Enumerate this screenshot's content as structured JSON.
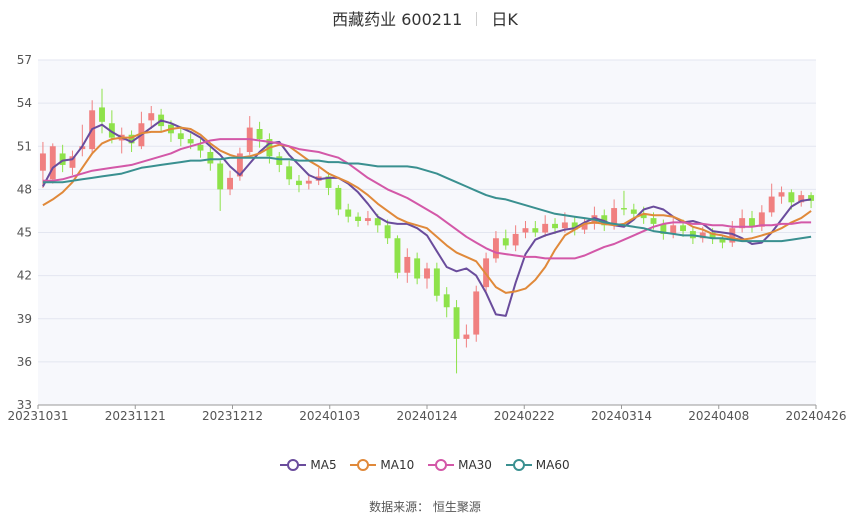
{
  "title": {
    "name": "西藏药业 600211",
    "period": "日K"
  },
  "source": "数据来源： 恒生聚源",
  "chart_data": {
    "type": "candlestick",
    "x_ticks": [
      "20231031",
      "20231121",
      "20231212",
      "20240103",
      "20240124",
      "20240222",
      "20240314",
      "20240408",
      "20240426"
    ],
    "y_ticks": [
      33,
      36,
      39,
      42,
      45,
      48,
      51,
      54,
      57
    ],
    "ylim": [
      33,
      57
    ],
    "grid": true,
    "legend_position": "bottom",
    "candle_colors": {
      "up": "#f08080",
      "down": "#8ee24a"
    },
    "series": [
      {
        "name": "MA5",
        "color": "#6a4c9c",
        "values": [
          48.2,
          49.5,
          50.0,
          50.1,
          51.0,
          52.2,
          52.5,
          52.0,
          51.6,
          51.3,
          51.8,
          52.3,
          52.8,
          52.6,
          52.3,
          52.0,
          51.6,
          51.0,
          50.4,
          49.6,
          49.0,
          49.8,
          50.6,
          51.2,
          51.3,
          50.4,
          49.7,
          49.0,
          48.7,
          48.8,
          48.8,
          48.4,
          47.8,
          47.0,
          46.1,
          45.7,
          45.6,
          45.6,
          45.3,
          44.8,
          43.7,
          42.6,
          42.3,
          42.5,
          42.0,
          40.8,
          39.3,
          39.2,
          41.5,
          43.5,
          44.5,
          44.8,
          45.0,
          45.2,
          45.3,
          45.7,
          46.0,
          45.8,
          45.5,
          45.4,
          45.9,
          46.6,
          46.8,
          46.6,
          46.1,
          45.7,
          45.8,
          45.6,
          45.1,
          45.0,
          44.9,
          44.6,
          44.2,
          44.3,
          45.0,
          45.9,
          46.8,
          47.2,
          47.3
        ]
      },
      {
        "name": "MA10",
        "color": "#e0893a",
        "values": [
          46.9,
          47.3,
          47.8,
          48.5,
          49.5,
          50.5,
          51.2,
          51.5,
          51.6,
          51.6,
          51.9,
          52.0,
          52.0,
          52.2,
          52.3,
          52.2,
          51.8,
          51.2,
          50.7,
          50.4,
          50.2,
          50.3,
          50.5,
          50.9,
          51.1,
          51.0,
          50.5,
          50.0,
          49.6,
          49.1,
          48.8,
          48.5,
          48.1,
          47.6,
          47.0,
          46.5,
          46.0,
          45.7,
          45.5,
          45.3,
          44.7,
          44.1,
          43.6,
          43.3,
          43.0,
          42.1,
          41.2,
          40.8,
          40.9,
          41.1,
          41.7,
          42.6,
          43.8,
          44.8,
          45.2,
          45.6,
          45.7,
          45.6,
          45.5,
          45.6,
          46.0,
          46.3,
          46.2,
          46.2,
          46.1,
          45.8,
          45.4,
          45.2,
          44.9,
          44.8,
          44.6,
          44.5,
          44.6,
          44.8,
          45.0,
          45.3,
          45.7,
          46.0,
          46.5
        ]
      },
      {
        "name": "MA30",
        "color": "#d358a8",
        "values": [
          48.6,
          48.6,
          48.7,
          48.9,
          49.1,
          49.3,
          49.4,
          49.5,
          49.6,
          49.7,
          49.9,
          50.1,
          50.3,
          50.5,
          50.8,
          51.0,
          51.2,
          51.4,
          51.5,
          51.5,
          51.5,
          51.5,
          51.4,
          51.3,
          51.2,
          51.0,
          50.8,
          50.7,
          50.6,
          50.4,
          50.2,
          49.8,
          49.3,
          48.8,
          48.4,
          48.0,
          47.7,
          47.4,
          47.0,
          46.6,
          46.2,
          45.7,
          45.2,
          44.7,
          44.3,
          43.9,
          43.6,
          43.5,
          43.4,
          43.3,
          43.3,
          43.2,
          43.2,
          43.2,
          43.2,
          43.4,
          43.7,
          44.0,
          44.2,
          44.5,
          44.8,
          45.1,
          45.4,
          45.6,
          45.7,
          45.7,
          45.6,
          45.6,
          45.5,
          45.5,
          45.4,
          45.4,
          45.4,
          45.5,
          45.5,
          45.6,
          45.6,
          45.7,
          45.7
        ]
      },
      {
        "name": "MA60",
        "color": "#3a9090",
        "values": [
          48.5,
          48.5,
          48.5,
          48.6,
          48.7,
          48.8,
          48.9,
          49.0,
          49.1,
          49.3,
          49.5,
          49.6,
          49.7,
          49.8,
          49.9,
          50.0,
          50.0,
          50.1,
          50.1,
          50.2,
          50.2,
          50.2,
          50.2,
          50.2,
          50.1,
          50.1,
          50.0,
          50.0,
          50.0,
          49.9,
          49.9,
          49.8,
          49.8,
          49.7,
          49.6,
          49.6,
          49.6,
          49.6,
          49.5,
          49.3,
          49.1,
          48.8,
          48.5,
          48.2,
          47.9,
          47.6,
          47.4,
          47.3,
          47.1,
          46.9,
          46.7,
          46.5,
          46.3,
          46.2,
          46.1,
          46.0,
          45.9,
          45.7,
          45.6,
          45.5,
          45.4,
          45.3,
          45.1,
          45.0,
          44.9,
          44.8,
          44.8,
          44.7,
          44.6,
          44.6,
          44.5,
          44.4,
          44.4,
          44.4,
          44.4,
          44.4,
          44.5,
          44.6,
          44.7
        ]
      }
    ],
    "candles": [
      [
        49.3,
        50.5,
        51.3,
        48.1
      ],
      [
        48.7,
        51.0,
        51.2,
        48.4
      ],
      [
        50.5,
        49.7,
        51.1,
        49.2
      ],
      [
        49.5,
        50.3,
        50.7,
        49.0
      ],
      [
        50.8,
        51.0,
        52.5,
        50.3
      ],
      [
        50.8,
        53.5,
        54.2,
        50.5
      ],
      [
        53.7,
        52.7,
        55.0,
        51.9
      ],
      [
        52.6,
        51.6,
        53.5,
        51.2
      ],
      [
        51.4,
        51.8,
        52.3,
        50.5
      ],
      [
        51.8,
        51.2,
        52.1,
        50.6
      ],
      [
        51.0,
        52.6,
        53.4,
        50.8
      ],
      [
        52.8,
        53.3,
        53.8,
        52.2
      ],
      [
        53.2,
        52.4,
        53.6,
        52.0
      ],
      [
        52.5,
        51.9,
        52.8,
        51.3
      ],
      [
        51.9,
        51.5,
        52.4,
        51.0
      ],
      [
        51.5,
        51.2,
        51.9,
        50.8
      ],
      [
        51.1,
        50.7,
        51.5,
        50.2
      ],
      [
        50.6,
        49.8,
        51.2,
        49.3
      ],
      [
        49.8,
        48.0,
        50.0,
        46.5
      ],
      [
        48.0,
        48.8,
        49.3,
        47.6
      ],
      [
        48.9,
        50.5,
        50.9,
        48.6
      ],
      [
        50.6,
        52.3,
        53.1,
        50.4
      ],
      [
        52.2,
        51.5,
        52.7,
        50.9
      ],
      [
        51.5,
        50.3,
        51.9,
        49.8
      ],
      [
        50.3,
        49.7,
        50.6,
        49.2
      ],
      [
        49.6,
        48.7,
        50.0,
        48.3
      ],
      [
        48.6,
        48.3,
        49.0,
        47.8
      ],
      [
        48.4,
        48.6,
        49.1,
        48.0
      ],
      [
        48.6,
        48.9,
        49.5,
        48.3
      ],
      [
        48.9,
        48.1,
        49.2,
        47.6
      ],
      [
        48.1,
        46.6,
        48.3,
        46.2
      ],
      [
        46.6,
        46.1,
        47.0,
        45.7
      ],
      [
        46.1,
        45.8,
        46.4,
        45.4
      ],
      [
        45.8,
        46.0,
        46.5,
        45.5
      ],
      [
        46.0,
        45.5,
        46.3,
        45.0
      ],
      [
        45.5,
        44.6,
        45.9,
        44.2
      ],
      [
        44.6,
        42.2,
        44.8,
        41.8
      ],
      [
        42.2,
        43.3,
        43.9,
        41.5
      ],
      [
        43.2,
        41.8,
        43.6,
        41.4
      ],
      [
        41.8,
        42.5,
        42.9,
        41.1
      ],
      [
        42.5,
        40.6,
        42.9,
        40.2
      ],
      [
        40.7,
        39.8,
        41.2,
        39.1
      ],
      [
        39.8,
        37.6,
        40.3,
        35.2
      ],
      [
        37.6,
        37.9,
        38.6,
        37.0
      ],
      [
        37.9,
        40.9,
        41.3,
        37.4
      ],
      [
        41.2,
        43.2,
        43.6,
        40.8
      ],
      [
        43.2,
        44.6,
        45.1,
        42.9
      ],
      [
        44.6,
        44.1,
        45.2,
        43.8
      ],
      [
        44.1,
        44.9,
        45.5,
        43.7
      ],
      [
        45.0,
        45.3,
        45.8,
        44.6
      ],
      [
        45.3,
        45.0,
        45.8,
        44.7
      ],
      [
        45.0,
        45.6,
        46.2,
        44.7
      ],
      [
        45.6,
        45.3,
        46.0,
        44.9
      ],
      [
        45.3,
        45.7,
        46.4,
        45.0
      ],
      [
        45.7,
        45.2,
        46.1,
        44.8
      ],
      [
        45.2,
        45.6,
        46.0,
        44.9
      ],
      [
        45.6,
        46.2,
        46.8,
        45.2
      ],
      [
        46.2,
        45.5,
        46.6,
        45.1
      ],
      [
        45.5,
        46.7,
        47.3,
        45.2
      ],
      [
        46.7,
        46.6,
        47.9,
        46.2
      ],
      [
        46.6,
        46.3,
        47.0,
        45.9
      ],
      [
        46.3,
        46.0,
        46.8,
        45.6
      ],
      [
        46.0,
        45.6,
        46.4,
        45.2
      ],
      [
        45.6,
        44.9,
        45.9,
        44.5
      ],
      [
        44.9,
        45.5,
        46.0,
        44.6
      ],
      [
        45.5,
        45.1,
        45.9,
        44.7
      ],
      [
        45.1,
        44.6,
        45.4,
        44.2
      ],
      [
        44.6,
        45.0,
        45.4,
        44.3
      ],
      [
        45.0,
        44.6,
        45.3,
        44.2
      ],
      [
        44.6,
        44.3,
        44.8,
        43.9
      ],
      [
        44.3,
        45.3,
        45.8,
        44.0
      ],
      [
        45.3,
        46.0,
        46.6,
        45.0
      ],
      [
        46.0,
        45.4,
        46.5,
        45.0
      ],
      [
        45.4,
        46.4,
        46.9,
        45.1
      ],
      [
        46.4,
        47.5,
        48.4,
        46.1
      ],
      [
        47.5,
        47.8,
        48.2,
        47.0
      ],
      [
        47.8,
        47.1,
        48.0,
        46.6
      ],
      [
        47.1,
        47.6,
        47.9,
        46.8
      ],
      [
        47.6,
        47.2,
        47.8,
        46.7
      ]
    ]
  },
  "legend": [
    {
      "label": "MA5",
      "color": "#6a4c9c"
    },
    {
      "label": "MA10",
      "color": "#e0893a"
    },
    {
      "label": "MA30",
      "color": "#d358a8"
    },
    {
      "label": "MA60",
      "color": "#3a9090"
    }
  ]
}
